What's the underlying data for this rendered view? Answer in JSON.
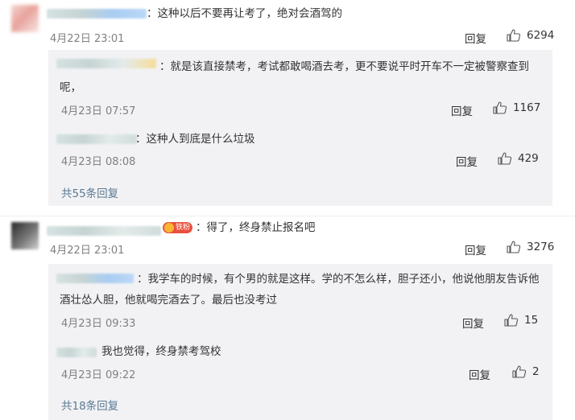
{
  "comments": [
    {
      "text": "：这种以后不要再让考了，绝对会酒驾的",
      "time": "4月22日 23:01",
      "reply_label": "回复",
      "likes": "6294",
      "subreplies": [
        {
          "text": "：就是该直接禁考，考试都敢喝酒去考，更不要说平时开车不一定被警察查到呢，",
          "time": "4月23日 07:57",
          "reply_label": "回复",
          "likes": "1167"
        },
        {
          "text": "：这种人到底是什么垃圾",
          "time": "4月23日 08:08",
          "reply_label": "回复",
          "likes": "429"
        }
      ],
      "more_replies": "共55条回复"
    },
    {
      "badge": "铁粉",
      "text": "：得了，终身禁止报名吧",
      "time": "4月22日 23:01",
      "reply_label": "回复",
      "likes": "3276",
      "subreplies": [
        {
          "text": "：我学车的时候，有个男的就是这样。学的不怎么样，胆子还小，他说他朋友告诉他酒壮怂人胆，他就喝完酒去了。最后也没考过",
          "time": "4月23日 09:33",
          "reply_label": "回复",
          "likes": "15"
        },
        {
          "text": "我也觉得，终身禁考驾校",
          "time": "4月23日 09:22",
          "reply_label": "回复",
          "likes": "2"
        }
      ],
      "more_replies": "共18条回复"
    }
  ],
  "icons": {
    "like": "thumbs-up-icon"
  },
  "colors": {
    "background": "#ffffff",
    "subreply_bg": "#f2f2f5",
    "more_link": "#5a7a92",
    "badge": "#e9513e"
  }
}
